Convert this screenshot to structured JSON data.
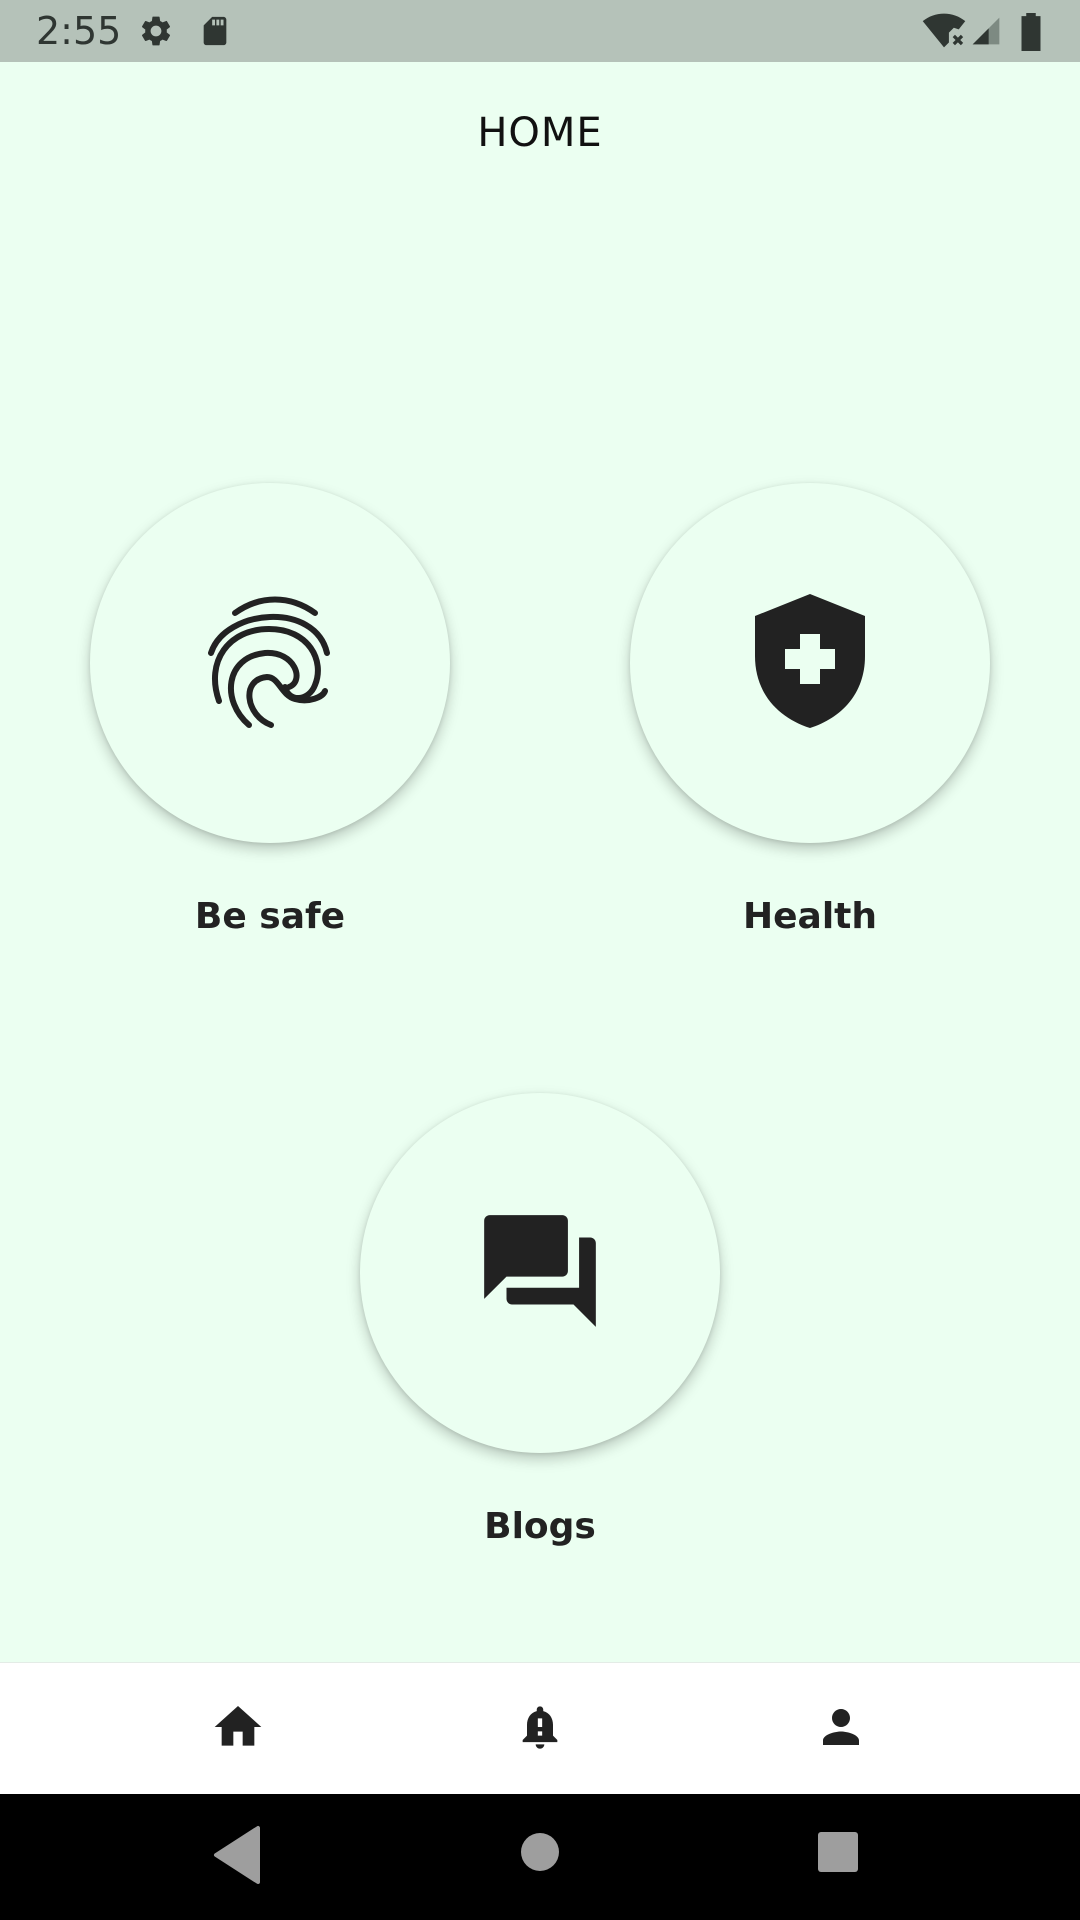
{
  "status_bar": {
    "time": "2:55",
    "icons": [
      "gear-icon",
      "sd-card-icon",
      "wifi-off-icon",
      "signal-icon",
      "battery-icon"
    ]
  },
  "header": {
    "title": "HOME"
  },
  "tiles": [
    {
      "label": "Be safe",
      "icon": "fingerprint-icon"
    },
    {
      "label": "Health",
      "icon": "health-shield-icon"
    },
    {
      "label": "Blogs",
      "icon": "forum-icon"
    }
  ],
  "bottom_nav": {
    "items": [
      {
        "icon": "home-icon"
      },
      {
        "icon": "notification-bell-icon"
      },
      {
        "icon": "person-icon"
      }
    ]
  },
  "system_nav": {
    "icons": [
      "back-icon",
      "home-circle-icon",
      "recents-icon"
    ]
  },
  "colors": {
    "background": "#ebfff1",
    "status_bar": "#b5c2b9",
    "icon": "#222222",
    "nav_background": "#ffffff"
  }
}
